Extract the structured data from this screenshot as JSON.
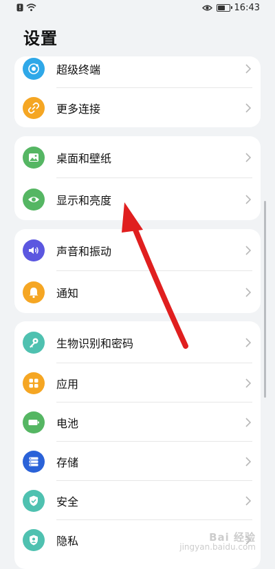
{
  "status_bar": {
    "time": "16:43",
    "battery_level": 0.7
  },
  "page": {
    "title": "设置"
  },
  "groups": [
    {
      "items": [
        {
          "label": "超级终端",
          "icon": "super-device-icon",
          "color": "#2fa8e8"
        },
        {
          "label": "更多连接",
          "icon": "link-icon",
          "color": "#f5a623"
        }
      ]
    },
    {
      "items": [
        {
          "label": "桌面和壁纸",
          "icon": "wallpaper-icon",
          "color": "#55b663"
        },
        {
          "label": "显示和亮度",
          "icon": "eye-icon",
          "color": "#55b663"
        }
      ]
    },
    {
      "items": [
        {
          "label": "声音和振动",
          "icon": "speaker-icon",
          "color": "#5b57e0"
        },
        {
          "label": "通知",
          "icon": "bell-icon",
          "color": "#f5a623"
        }
      ]
    },
    {
      "items": [
        {
          "label": "生物识别和密码",
          "icon": "key-icon",
          "color": "#4fc1b0"
        },
        {
          "label": "应用",
          "icon": "apps-icon",
          "color": "#f5a623"
        },
        {
          "label": "电池",
          "icon": "battery-icon",
          "color": "#55b663"
        },
        {
          "label": "存储",
          "icon": "storage-icon",
          "color": "#2a62d8"
        },
        {
          "label": "安全",
          "icon": "shield-icon",
          "color": "#4fc1b0"
        },
        {
          "label": "隐私",
          "icon": "privacy-icon",
          "color": "#4fc1b0"
        }
      ]
    }
  ],
  "watermark": {
    "main": "Bai 经验",
    "sub": "jingyan.baidu.com"
  },
  "annotation": {
    "color": "#e01f1f"
  }
}
